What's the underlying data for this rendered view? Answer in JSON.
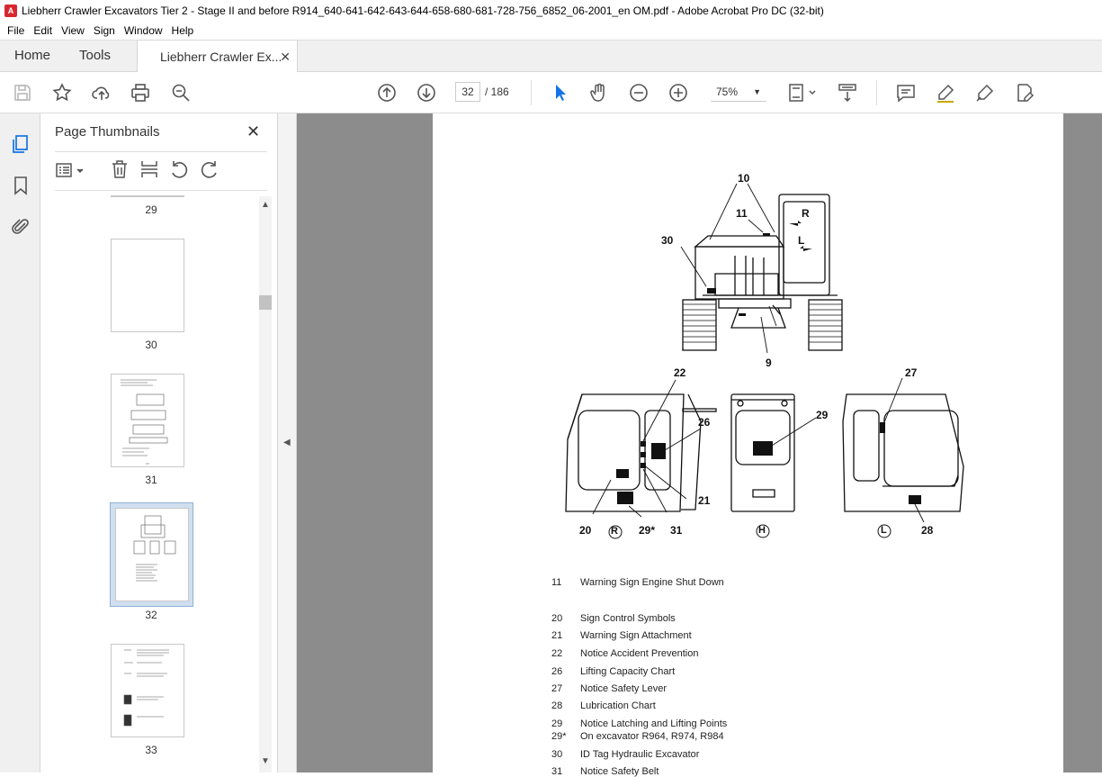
{
  "window": {
    "title": "Liebherr Crawler Excavators Tier 2 - Stage II and before  R914_640-641-642-643-644-658-680-681-728-756_6852_06-2001_en OM.pdf - Adobe Acrobat Pro DC (32-bit)"
  },
  "menu": [
    "File",
    "Edit",
    "View",
    "Sign",
    "Window",
    "Help"
  ],
  "tabs": {
    "home": "Home",
    "tools": "Tools",
    "document": "Liebherr Crawler Ex..."
  },
  "toolbar": {
    "current_page": "32",
    "page_total": "/  186",
    "zoom": "75%"
  },
  "thumbnails": {
    "title": "Page Thumbnails",
    "pages": [
      "29",
      "30",
      "31",
      "32",
      "33"
    ],
    "selected": "32"
  },
  "diagram": {
    "labels_top": [
      "10",
      "11",
      "30",
      "9"
    ],
    "labels_bottom": [
      "22",
      "26",
      "21",
      "20",
      "29*",
      "31",
      "29",
      "27",
      "28"
    ],
    "view_marks": [
      "R",
      "H",
      "L"
    ],
    "cab_marks": [
      "R",
      "L"
    ]
  },
  "legend": [
    {
      "num": "11",
      "text": "Warning Sign Engine Shut Down"
    },
    {
      "num": "20",
      "text": "Sign Control Symbols"
    },
    {
      "num": "21",
      "text": "Warning Sign Attachment"
    },
    {
      "num": "22",
      "text": "Notice Accident Prevention"
    },
    {
      "num": "26",
      "text": "Lifting Capacity Chart"
    },
    {
      "num": "27",
      "text": "Notice Safety Lever"
    },
    {
      "num": "28",
      "text": "Lubrication Chart"
    },
    {
      "num": "29",
      "text": "Notice Latching and Lifting Points"
    },
    {
      "num": "29*",
      "text": "On excavator R964, R974, R984"
    },
    {
      "num": "30",
      "text": "ID Tag Hydraulic Excavator"
    },
    {
      "num": "31",
      "text": "Notice Safety Belt"
    }
  ],
  "colors": {
    "accent": "#1473e6",
    "doc_bg": "#8c8c8c",
    "selected_thumb": "#d0dff0"
  }
}
